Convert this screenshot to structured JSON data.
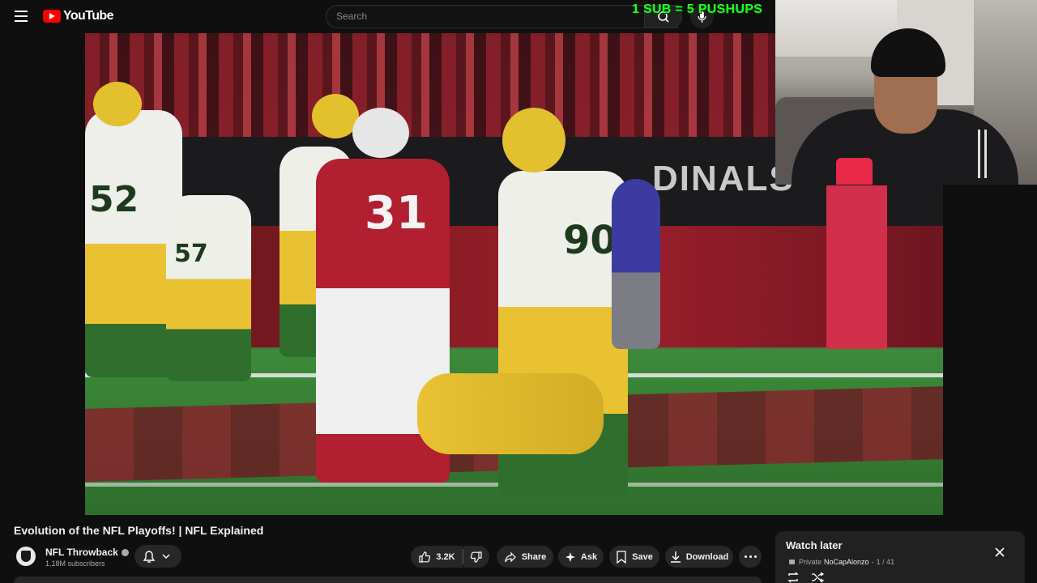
{
  "app": {
    "name": "YouTube"
  },
  "search": {
    "placeholder": "Search"
  },
  "stream_overlay": {
    "text": "1 SUB = 5 PUSHUPS"
  },
  "video": {
    "title": "Evolution of the NFL Playoffs! | NFL Explained",
    "scene": {
      "banner_text": "DINALS",
      "pylon_text": "DINALS"
    },
    "jerseys": [
      "52",
      "31",
      "90",
      "57"
    ]
  },
  "channel": {
    "name": "NFL Throwback",
    "subscribers": "1.18M subscribers"
  },
  "actions": {
    "like_count": "3.2K",
    "share": "Share",
    "ask": "Ask",
    "save": "Save",
    "download": "Download"
  },
  "playlist": {
    "title": "Watch later",
    "privacy": "Private",
    "owner": "NoCapAlonzo",
    "position": "1 / 41"
  },
  "colors": {
    "brand_red": "#ff0000",
    "background": "#0f0f0f",
    "overlay_green": "#22ff22"
  }
}
